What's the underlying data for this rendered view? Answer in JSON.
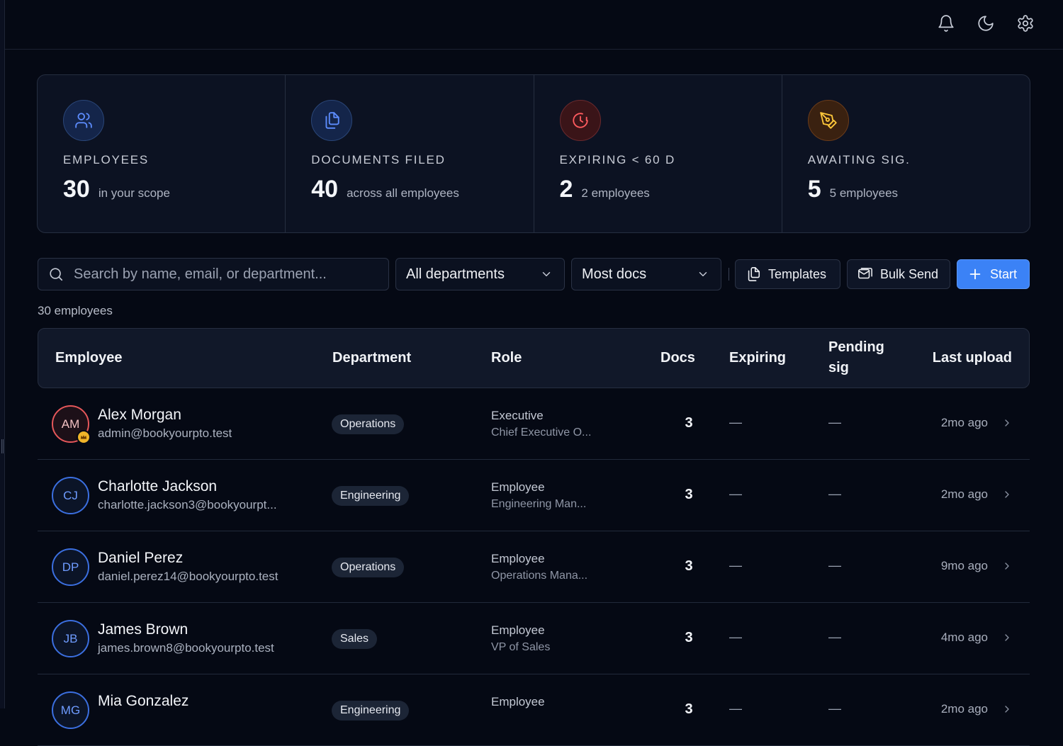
{
  "topbar": {
    "icons": [
      "bell-icon",
      "moon-icon",
      "gear-icon"
    ]
  },
  "stats": [
    {
      "icon": "users-icon",
      "label": "EMPLOYEES",
      "value": "30",
      "sub": "in your scope",
      "color": "#5d8dff"
    },
    {
      "icon": "documents-icon",
      "label": "DOCUMENTS FILED",
      "value": "40",
      "sub": "across all employees",
      "color": "#5d8dff"
    },
    {
      "icon": "clock-alert-icon",
      "label": "EXPIRING < 60 D",
      "value": "2",
      "sub": "2 employees",
      "color": "#ff5b5f"
    },
    {
      "icon": "pen-tool-icon",
      "label": "AWAITING SIG.",
      "value": "5",
      "sub": "5 employees",
      "color": "#ffc83a"
    }
  ],
  "toolbar": {
    "search_placeholder": "Search by name, email, or department...",
    "department_filter": "All departments",
    "sort_filter": "Most docs",
    "templates_label": "Templates",
    "bulk_send_label": "Bulk Send",
    "start_label": "Start",
    "accent": "#3b82f6"
  },
  "employee_count": "30 employees",
  "table": {
    "headers": {
      "employee": "Employee",
      "department": "Department",
      "role": "Role",
      "docs": "Docs",
      "expiring": "Expiring",
      "pending_sig_1": "Pending",
      "pending_sig_2": "sig",
      "last_upload": "Last upload"
    },
    "rows": [
      {
        "initials": "AM",
        "name": "Alex Morgan",
        "email": "admin@bookyourpto.test",
        "department": "Operations",
        "role": "Executive",
        "title": "Chief Executive O...",
        "docs": "3",
        "expiring": "—",
        "pending": "—",
        "last_upload": "2mo ago"
      },
      {
        "initials": "CJ",
        "name": "Charlotte Jackson",
        "email": "charlotte.jackson3@bookyourpt...",
        "department": "Engineering",
        "role": "Employee",
        "title": "Engineering Man...",
        "docs": "3",
        "expiring": "—",
        "pending": "—",
        "last_upload": "2mo ago"
      },
      {
        "initials": "DP",
        "name": "Daniel Perez",
        "email": "daniel.perez14@bookyourpto.test",
        "department": "Operations",
        "role": "Employee",
        "title": "Operations Mana...",
        "docs": "3",
        "expiring": "—",
        "pending": "—",
        "last_upload": "9mo ago"
      },
      {
        "initials": "JB",
        "name": "James Brown",
        "email": "james.brown8@bookyourpto.test",
        "department": "Sales",
        "role": "Employee",
        "title": "VP of Sales",
        "docs": "3",
        "expiring": "—",
        "pending": "—",
        "last_upload": "4mo ago"
      },
      {
        "initials": "MG",
        "name": "Mia Gonzalez",
        "email": "",
        "department": "Engineering",
        "role": "Employee",
        "title": "",
        "docs": "3",
        "expiring": "—",
        "pending": "—",
        "last_upload": "2mo ago"
      }
    ]
  }
}
